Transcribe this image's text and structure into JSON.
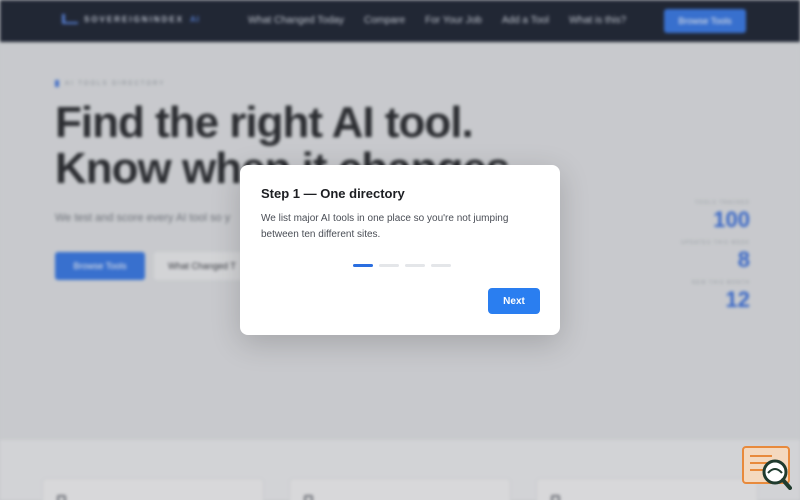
{
  "header": {
    "brand": "SOVEREIGNINDEX",
    "brand_suffix": "AI",
    "nav": [
      "What Changed Today",
      "Compare",
      "For Your Job",
      "Add a Tool",
      "What is this?"
    ],
    "cta": "Browse Tools"
  },
  "hero": {
    "eyebrow": "AI TOOLS DIRECTORY",
    "headline_line1": "Find the right AI tool.",
    "headline_line2": "Know when it changes.",
    "subline": "We test and score every AI tool so y",
    "primary_button": "Browse Tools",
    "secondary_button": "What Changed T"
  },
  "stats": [
    {
      "label": "TOOLS TRACKED",
      "value": "100"
    },
    {
      "label": "UPDATES THIS WEEK",
      "value": "8"
    },
    {
      "label": "NEW THIS MONTH",
      "value": "12"
    }
  ],
  "modal": {
    "title": "Step 1 — One directory",
    "body": "We list major AI tools in one place so you're not jumping between ten different sites.",
    "steps_total": 4,
    "active_step": 1,
    "next_label": "Next"
  },
  "colors": {
    "accent": "#2a6ee0",
    "nav_bg": "#0e1524",
    "stat_value": "#2a63d6",
    "help_widget": "#e88a3c"
  }
}
